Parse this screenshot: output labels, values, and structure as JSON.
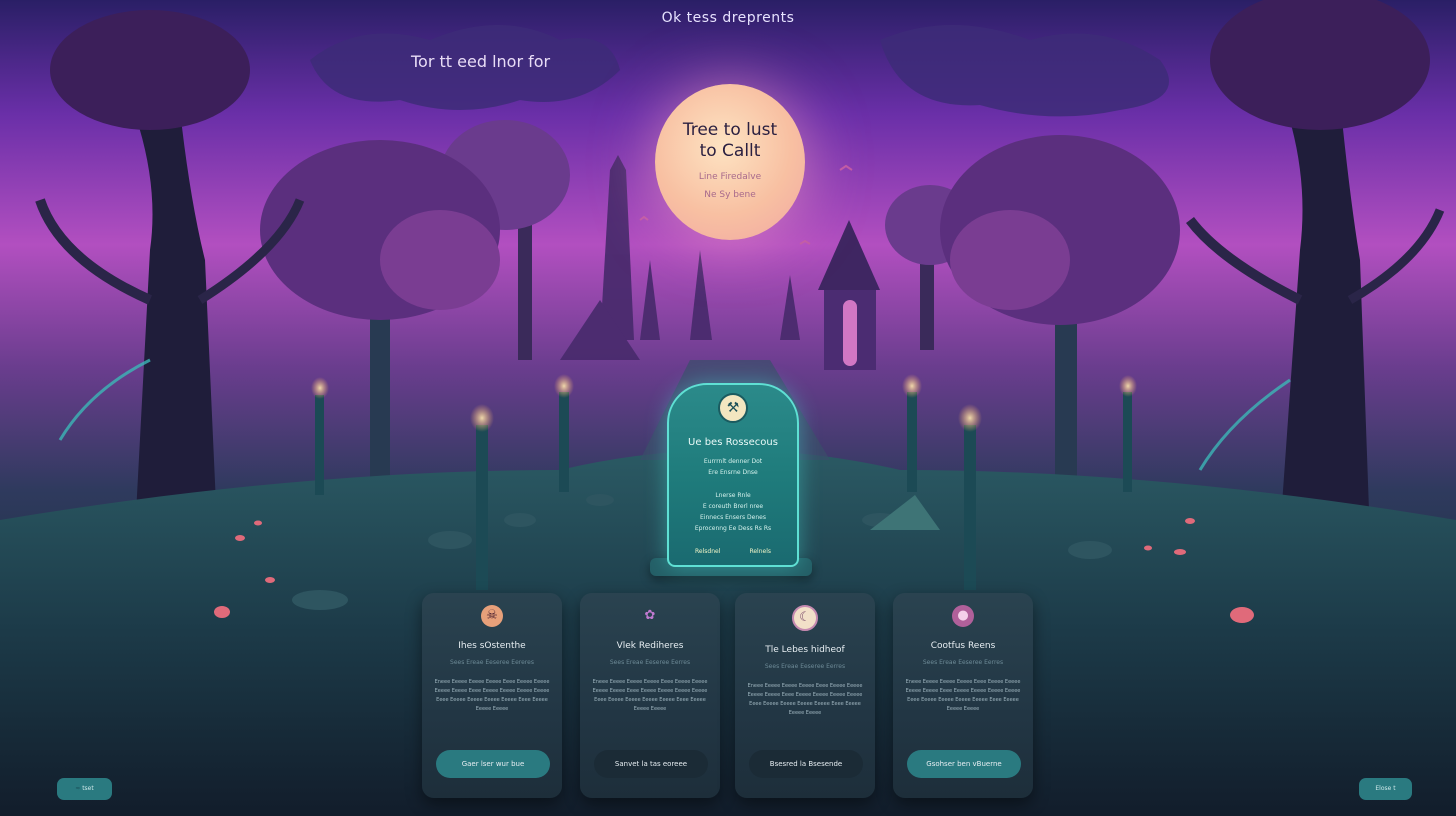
{
  "header": {
    "title": "Ok tess dreprents",
    "tagline": "Tor tt eed lnor for"
  },
  "moon_panel": {
    "heading": "Tree to lust\nto Callt",
    "sub_line_1": "Line Firedalve",
    "sub_line_2": "Ne Sy bene"
  },
  "tombstone": {
    "emblem_icon": "pickaxe-icon",
    "title": "Ue bes Rossecous",
    "lines_a": [
      "Eurrrnlt denner Dot",
      "Ere Ensrne Dnse"
    ],
    "lines_b": [
      "Lnerse Rnle",
      "E coreuth Brerl nree",
      "Einnecs Ensers Denes",
      "Eprocenng Ee Dess Rs Rs"
    ],
    "footer_left": "Relsdnel",
    "footer_right": "Relnels"
  },
  "cards": [
    {
      "icon": "skull-icon",
      "title": "Ihes sOstenthe",
      "subtitle": "Sees Ereae Eeseree Eereres",
      "body": "Eneee Eeeee Eeeee Eeeee Eeee Eeeee Eeeee Eeeee Eeeee Eeee Eeeee Eeeee Eeeee Eeeee Eeee Eeeee Eeeee Eeeee Eeeee Eeee Eeeee Eeeee Eeeee",
      "button": "Gaer lser wur bue"
    },
    {
      "icon": "leaf-icon",
      "title": "Vlek Rediheres",
      "subtitle": "Sees Ereae Eeseree Eerres",
      "body": "Eneee Eeeee Eeeee Eeeee Eeee Eeeee Eeeee Eeeee Eeeee Eeee Eeeee Eeeee Eeeee Eeeee Eeee Eeeee Eeeee Eeeee Eeeee Eeee Eeeee Eeeee Eeeee",
      "button": "Sanvet la tas eoreee"
    },
    {
      "icon": "moon-icon",
      "title": "Tle Lebes hidheof",
      "subtitle": "Sees Ereae Eeseree Eerres",
      "body": "Eneee Eeeee Eeeee Eeeee Eeee Eeeee Eeeee Eeeee Eeeee Eeee Eeeee Eeeee Eeeee Eeeee Eeee Eeeee Eeeee Eeeee Eeeee Eeee Eeeee Eeeee Eeeee",
      "button": "Bsesred la Bsesende"
    },
    {
      "icon": "ghost-icon",
      "title": "Cootfus Reens",
      "subtitle": "Sees Ereae Eeseree Eerres",
      "body": "Eneee Eeeee Eeeee Eeeee Eeee Eeeee Eeeee Eeeee Eeeee Eeee Eeeee Eeeee Eeeee Eeeee Eeee Eeeee Eeeee Eeeee Eeeee Eeee Eeeee Eeeee Eeeee",
      "button": "Gsohser ben vBuerne"
    }
  ],
  "corner_left": "tset",
  "corner_right": "Elose t"
}
